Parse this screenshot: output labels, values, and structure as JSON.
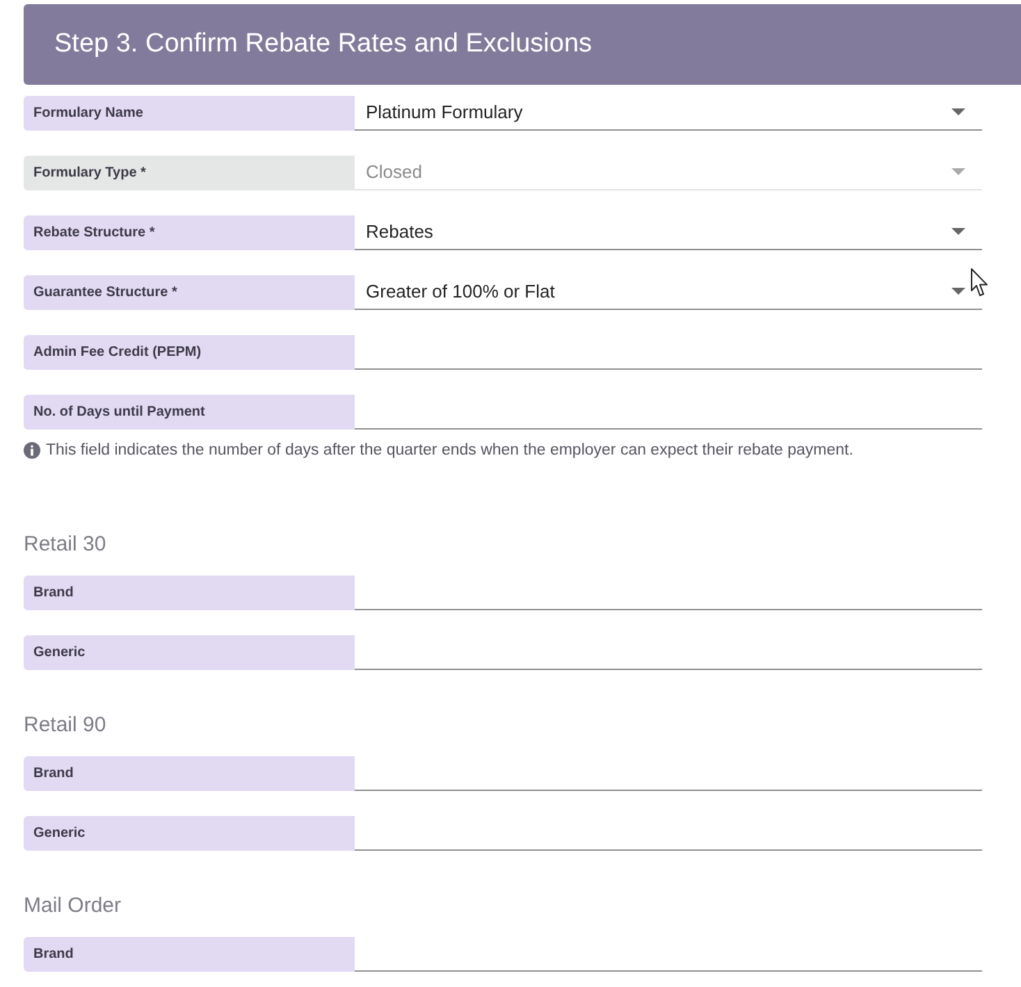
{
  "header": {
    "title": "Step 3. Confirm Rebate Rates and Exclusions"
  },
  "fields": [
    {
      "label": "Formulary Name",
      "kind": "dropdown",
      "value": "Platinum Formulary",
      "disabled": false
    },
    {
      "label": "Formulary Type *",
      "kind": "dropdown",
      "value": "Closed",
      "disabled": true
    },
    {
      "label": "Rebate Structure *",
      "kind": "dropdown",
      "value": "Rebates",
      "disabled": false
    },
    {
      "label": "Guarantee Structure *",
      "kind": "dropdown",
      "value": "Greater of 100% or Flat",
      "disabled": false
    },
    {
      "label": "Admin Fee Credit (PEPM)",
      "kind": "text",
      "disabled": false
    },
    {
      "label": "No. of Days until Payment",
      "kind": "text",
      "disabled": false
    }
  ],
  "note": {
    "text": "This field indicates the number of days after the quarter ends when the employer can expect their rebate payment."
  },
  "sections": [
    {
      "title": "Retail 30",
      "fields": [
        {
          "label": "Brand"
        },
        {
          "label": "Generic"
        }
      ]
    },
    {
      "title": "Retail 90",
      "fields": [
        {
          "label": "Brand"
        },
        {
          "label": "Generic"
        }
      ]
    },
    {
      "title": "Mail Order",
      "fields": [
        {
          "label": "Brand"
        }
      ]
    }
  ]
}
